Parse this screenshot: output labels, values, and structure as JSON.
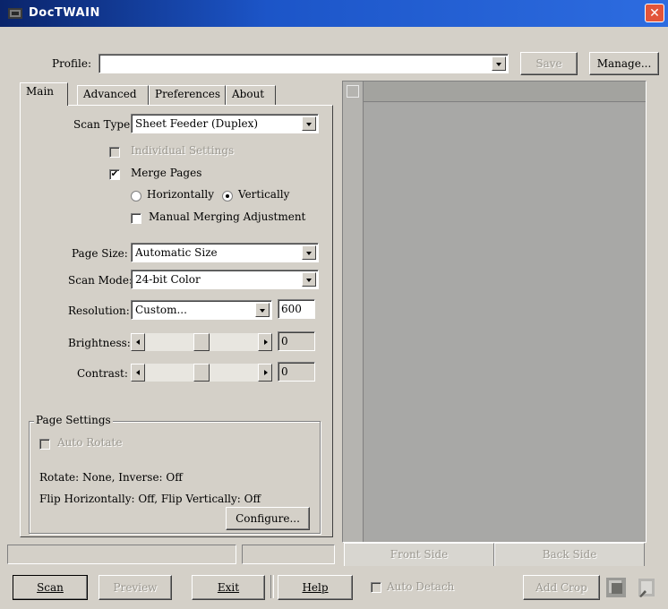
{
  "window": {
    "title": "DocTWAIN",
    "close_glyph": "✕"
  },
  "profile": {
    "label": "Profile:",
    "value": "",
    "save_label": "Save",
    "manage_label": "Manage..."
  },
  "tabs": [
    {
      "label": "Main",
      "active": true
    },
    {
      "label": "Advanced",
      "active": false
    },
    {
      "label": "Preferences",
      "active": false
    },
    {
      "label": "About",
      "active": false
    }
  ],
  "main": {
    "scan_type": {
      "label": "Scan Type:",
      "value": "Sheet Feeder (Duplex)"
    },
    "individual_settings": {
      "label": "Individual Settings",
      "checked": false,
      "enabled": false
    },
    "merge_pages": {
      "label": "Merge Pages",
      "checked": true
    },
    "horizontally": {
      "label": "Horizontally",
      "selected": false
    },
    "vertically": {
      "label": "Vertically",
      "selected": true
    },
    "manual_merging": {
      "label": "Manual Merging Adjustment",
      "checked": false
    },
    "page_size": {
      "label": "Page Size:",
      "value": "Automatic Size"
    },
    "scan_mode": {
      "label": "Scan Mode:",
      "value": "24-bit Color"
    },
    "resolution": {
      "label": "Resolution:",
      "value": "Custom...",
      "number": "600"
    },
    "brightness": {
      "label": "Brightness:",
      "value": "0",
      "level": 0.5
    },
    "contrast": {
      "label": "Contrast:",
      "value": "0",
      "level": 0.5
    },
    "page_settings": {
      "title": "Page Settings",
      "auto_rotate": {
        "label": "Auto Rotate",
        "checked": false,
        "enabled": false
      },
      "rotate_line": "Rotate: None, Inverse: Off",
      "flip_line": "Flip Horizontally: Off, Flip Vertically: Off",
      "configure_label": "Configure..."
    }
  },
  "preview": {
    "front_side_tab": "Front Side",
    "back_side_tab": "Back Side"
  },
  "footer": {
    "scan_label": "Scan",
    "preview_label": "Preview",
    "exit_label": "Exit",
    "help_label": "Help",
    "auto_detach_label": "Auto Detach",
    "add_crop_label": "Add Crop"
  }
}
